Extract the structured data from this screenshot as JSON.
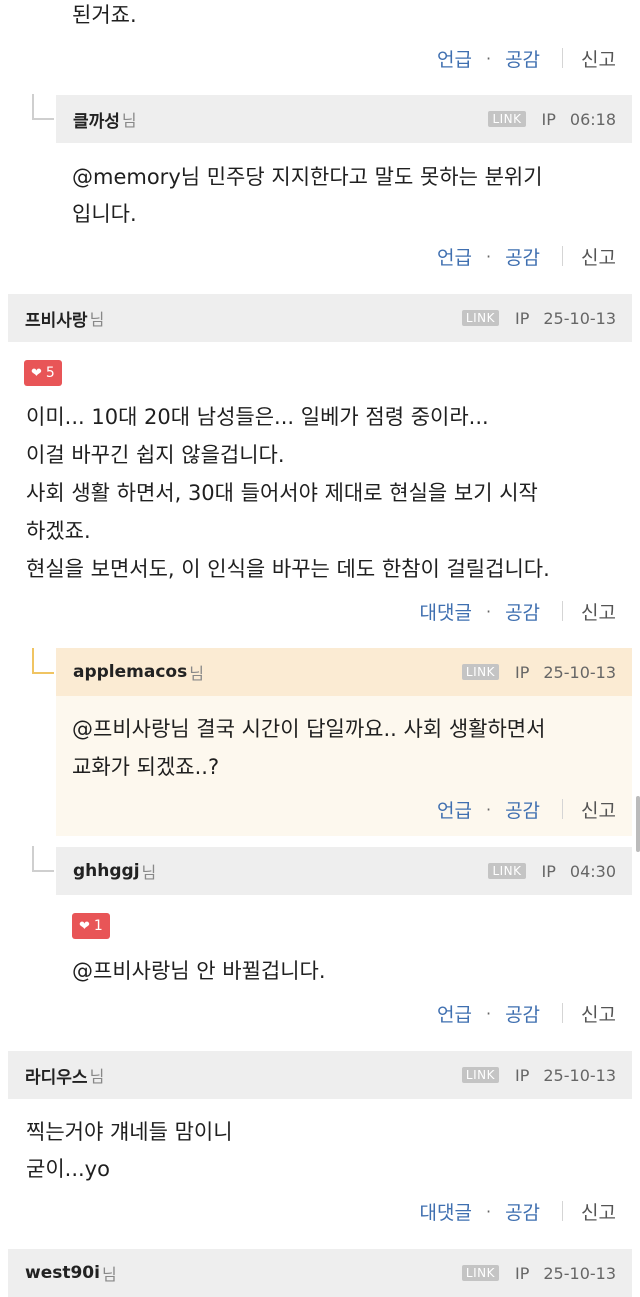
{
  "comments": [
    {
      "body_lines": [
        "된거죠."
      ],
      "actions": {
        "reply": "언급",
        "like": "공감",
        "report": "신고"
      }
    },
    {
      "nickname": "클까성",
      "suffix": "님",
      "link": "LINK",
      "ip": "IP",
      "time": "06:18",
      "body_lines": [
        "@memory님 민주당 지지한다고 말도 못하는 분위기",
        "입니다."
      ],
      "actions": {
        "reply": "언급",
        "like": "공감",
        "report": "신고"
      }
    },
    {
      "nickname": "프비사랑",
      "suffix": "님",
      "link": "LINK",
      "ip": "IP",
      "time": "25-10-13",
      "likes": "5",
      "body_lines": [
        "이미... 10대 20대 남성들은... 일베가 점령 중이라...",
        "이걸 바꾸긴 쉽지 않을겁니다.",
        "사회 생활 하면서, 30대 들어서야 제대로 현실을 보기 시작",
        "하겠죠.",
        "현실을 보면서도, 이 인식을 바꾸는 데도 한참이 걸릴겁니다."
      ],
      "actions": {
        "reply": "대댓글",
        "like": "공감",
        "report": "신고"
      }
    },
    {
      "nickname": "applemacos",
      "suffix": "님",
      "link": "LINK",
      "ip": "IP",
      "time": "25-10-13",
      "body_lines": [
        "@프비사랑님 결국 시간이 답일까요.. 사회 생활하면서",
        "교화가 되겠죠..?"
      ],
      "actions": {
        "reply": "언급",
        "like": "공감",
        "report": "신고"
      }
    },
    {
      "nickname": "ghhggj",
      "suffix": "님",
      "link": "LINK",
      "ip": "IP",
      "time": "04:30",
      "likes": "1",
      "body_lines": [
        "@프비사랑님 안 바뀔겁니다."
      ],
      "actions": {
        "reply": "언급",
        "like": "공감",
        "report": "신고"
      }
    },
    {
      "nickname": "라디우스",
      "suffix": "님",
      "link": "LINK",
      "ip": "IP",
      "time": "25-10-13",
      "body_lines": [
        "찍는거야 걔네들 맘이니",
        "굳이...yo"
      ],
      "actions": {
        "reply": "대댓글",
        "like": "공감",
        "report": "신고"
      }
    },
    {
      "nickname": "west90i",
      "suffix": "님",
      "link": "LINK",
      "ip": "IP",
      "time": "25-10-13"
    }
  ],
  "colors": {
    "header_gray": "#eeeeee",
    "header_cream": "#fbebd3",
    "action_blue": "#3f6fb0",
    "like_red": "#e85557"
  },
  "icons": {
    "like_badge": "heart-icon"
  }
}
